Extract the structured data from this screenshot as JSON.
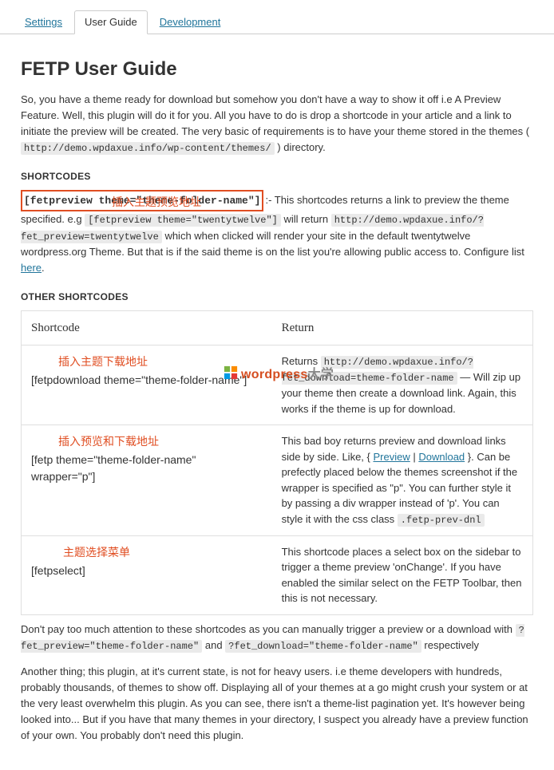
{
  "tabs": {
    "settings": "Settings",
    "user_guide": "User Guide",
    "development": "Development"
  },
  "title": "FETP User Guide",
  "intro_a": "So, you have a theme ready for download but somehow you don't have a way to show it off i.e A Preview Feature. Well, this plugin will do it for you. All you have to do is drop a shortcode in your article and a link to initiate the preview will be created. The very basic of requirements is to have your theme stored in the themes ( ",
  "intro_code": "http://demo.wpdaxue.info/wp-content/themes/",
  "intro_b": " ) directory.",
  "sec1": "SHORTCODES",
  "anno1": "插入主题预览地址",
  "sc_box": "[fetpreview theme=\"theme-folder-name\"]",
  "sc_after_a": ":- This shortcodes returns a link to preview the theme specified. e.g ",
  "sc_code2": "[fetpreview theme=\"twentytwelve\"]",
  "sc_after_b": " will return ",
  "sc_code3": "http://demo.wpdaxue.info/?fet_preview=twentytwelve",
  "sc_after_c": " which when clicked will render your site in the default twentytwelve wordpress.org Theme. But that is if the said theme is on the list you're allowing public access to. Configure list ",
  "here": "here",
  "sec2": "OTHER SHORTCODES",
  "th1": "Shortcode",
  "th2": "Return",
  "row1": {
    "anno": "插入主题下载地址",
    "sc": "[fetpdownload theme=\"theme-folder-name\"]",
    "ret_a": "Returns ",
    "ret_code": "http://demo.wpdaxue.info/?fet_download=theme-folder-name",
    "ret_b": " — Will zip up your theme then create a download link. Again, this works if the theme is up for download."
  },
  "row2": {
    "anno": "插入预览和下载地址",
    "sc": "[fetp theme=\"theme-folder-name\" wrapper=\"p\"]",
    "ret_a": "This bad boy returns preview and download links side by side. Like, { ",
    "link1": "Preview",
    "mid": " | ",
    "link2": "Download",
    "ret_b": " }. Can be prefectly placed below the themes screenshot if the wrapper is specified as \"p\". You can further style it by passing a div wrapper instead of 'p'. You can style it with the css class ",
    "ret_code": ".fetp-prev-dnl"
  },
  "row3": {
    "anno": "主题选择菜单",
    "sc": "[fetpselect]",
    "ret": "This shortcode places a select box on the sidebar to trigger a theme preview 'onChange'. If you have enabled the similar select on the FETP Toolbar, then this is not necessary."
  },
  "para2_a": "Don't pay too much attention to these shortcodes as you can manually trigger a preview or a download with ",
  "para2_code1": "?fet_preview=\"theme-folder-name\"",
  "para2_b": " and ",
  "para2_code2": "?fet_download=\"theme-folder-name\"",
  "para2_c": " respectively",
  "para3": "Another thing; this plugin, at it's current state, is not for heavy users. i.e theme developers with hundreds, probably thousands, of themes to show off. Displaying all of your themes at a go might crush your system or at the very least overwhelm this plugin. As you can see, there isn't a theme-list pagination yet. It's however being looked into... But if you have that many themes in your directory, I suspect you already have a preview function of your own. You probably don't need this plugin.",
  "watermark": {
    "a": "wordpress",
    "b": "大学"
  }
}
